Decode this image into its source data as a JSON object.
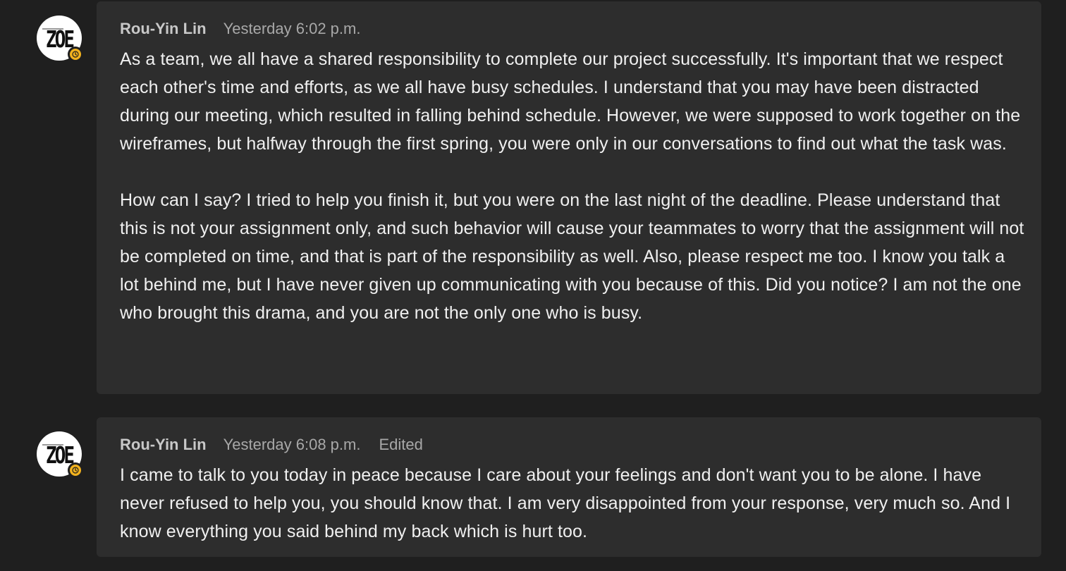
{
  "messages": [
    {
      "avatar_text": "ZOE",
      "author": "Rou-Yin Lin",
      "timestamp": "Yesterday 6:02 p.m.",
      "edited": "",
      "paragraphs": [
        "As a team, we all have a shared responsibility to complete our project successfully. It's important that we respect each other's time and efforts, as we all have busy schedules. I understand that you may have been distracted during our meeting, which resulted in falling behind schedule. However, we were supposed to work together on the wireframes, but halfway through the first spring, you were only in our conversations to find out what the task was.",
        "How can I say? I tried to help you finish it, but you were on the last night of the deadline. Please understand that this is not your assignment only, and such behavior will cause your teammates to worry that the assignment will not be completed on time, and that is part of the responsibility as well. Also, please respect me too. I know you talk a lot behind me, but I have never given up communicating with you because of this. Did you notice? I am not the one who brought this drama, and you are not the only one who is busy."
      ]
    },
    {
      "avatar_text": "ZOE",
      "author": "Rou-Yin Lin",
      "timestamp": "Yesterday 6:08 p.m.",
      "edited": "Edited",
      "paragraphs": [
        "I came to talk to you today in peace because I care about your feelings and don't want you to be alone. I have never refused to help you, you should know that. I am very disappointed from your response, very much so. And I know everything you said behind my back which is hurt too."
      ]
    }
  ],
  "colors": {
    "background": "#1f1f1f",
    "bubble": "#2d2d2d",
    "status_away": "#f2b21e",
    "text": "#f0f0f0",
    "meta": "#a8a8a8"
  },
  "icons": {
    "status": "clock-icon"
  }
}
